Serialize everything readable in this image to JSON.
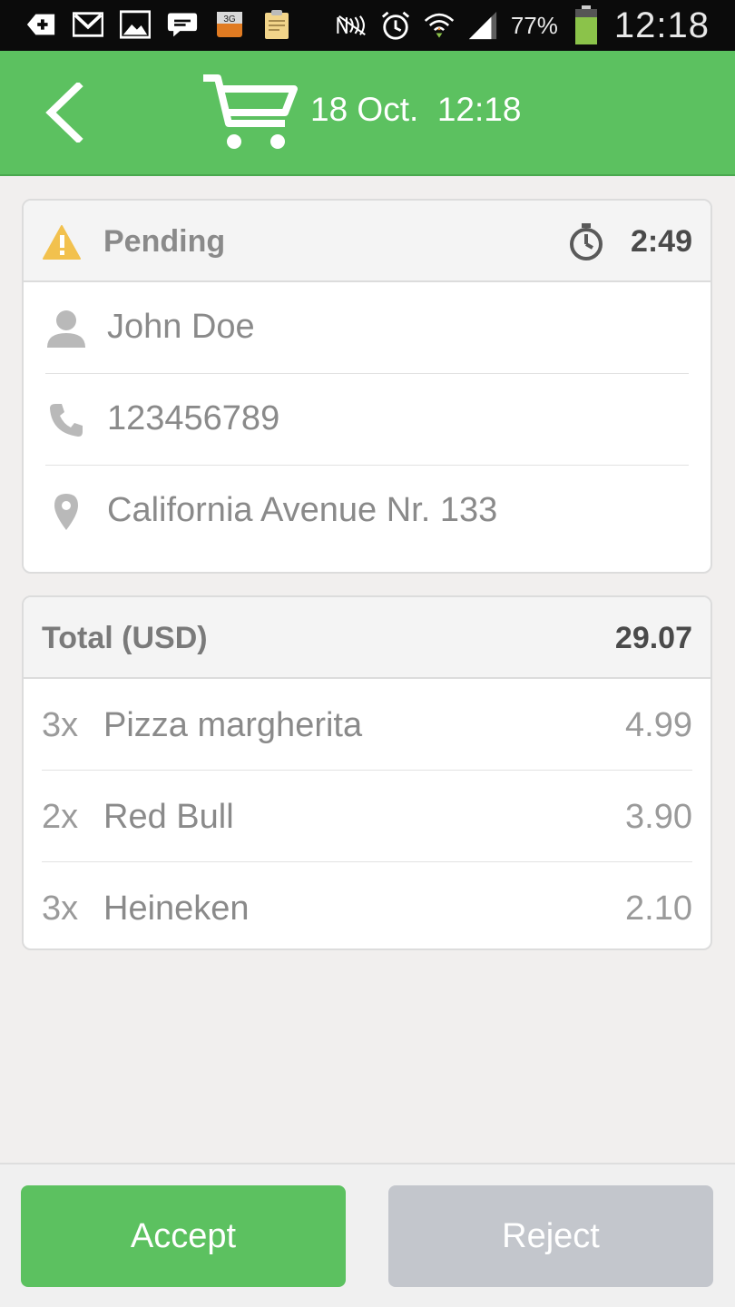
{
  "status_bar": {
    "network": "3G",
    "battery_percent": "77%",
    "time": "12:18"
  },
  "header": {
    "title": "18 Oct.  12:18",
    "back_icon": "chevron-left-icon",
    "cart_icon": "shopping-cart-icon"
  },
  "order": {
    "status": "Pending",
    "status_icon": "warning-icon",
    "timer_icon": "stopwatch-icon",
    "timer": "2:49",
    "customer": {
      "name": "John Doe",
      "phone": "123456789",
      "address": "California Avenue Nr. 133"
    }
  },
  "summary": {
    "total_label": "Total (USD)",
    "total_value": "29.07",
    "items": [
      {
        "qty": "3x",
        "name": "Pizza margherita",
        "price": "4.99"
      },
      {
        "qty": "2x",
        "name": "Red Bull",
        "price": "3.90"
      },
      {
        "qty": "3x",
        "name": "Heineken",
        "price": "2.10"
      }
    ]
  },
  "actions": {
    "accept": "Accept",
    "reject": "Reject"
  },
  "colors": {
    "accent": "#5cc160",
    "reject": "#c3c6cc",
    "warning": "#f2c14e"
  }
}
